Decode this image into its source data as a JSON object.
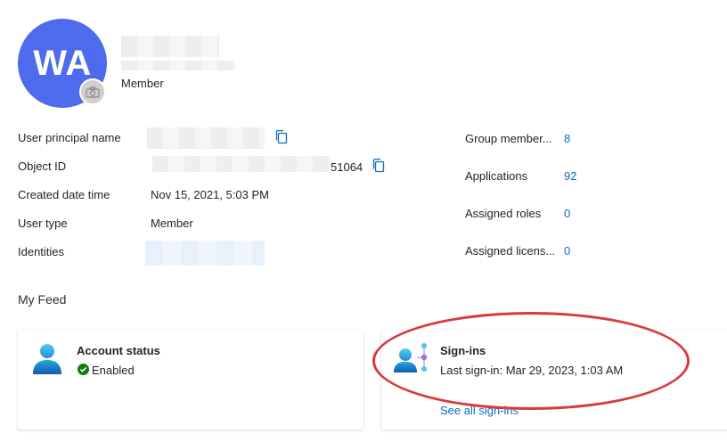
{
  "profile": {
    "initials": "WA",
    "role": "Member"
  },
  "properties": [
    {
      "label": "User principal name"
    },
    {
      "label": "Object ID",
      "value_suffix": "51064"
    },
    {
      "label": "Created date time",
      "value": "Nov 15, 2021, 5:03 PM"
    },
    {
      "label": "User type",
      "value": "Member"
    },
    {
      "label": "Identities"
    }
  ],
  "stats": [
    {
      "label": "Group member...",
      "value": "8"
    },
    {
      "label": "Applications",
      "value": "92"
    },
    {
      "label": "Assigned roles",
      "value": "0"
    },
    {
      "label": "Assigned licens...",
      "value": "0"
    }
  ],
  "feed": {
    "title": "My Feed",
    "account_status": {
      "title": "Account status",
      "status": "Enabled"
    },
    "signins": {
      "title": "Sign-ins",
      "last": "Last sign-in: Mar 29, 2023, 1:03 AM",
      "link": "See all sign-ins"
    }
  },
  "icons": {
    "copy": "copy-icon",
    "camera": "camera-icon",
    "user": "user-icon",
    "signin": "signin-icon",
    "check": "check-circle-icon"
  },
  "colors": {
    "avatar": "#4f6bed",
    "link": "#0f6cbd",
    "enabled": "#107c10",
    "annotation": "#d93a3d"
  }
}
